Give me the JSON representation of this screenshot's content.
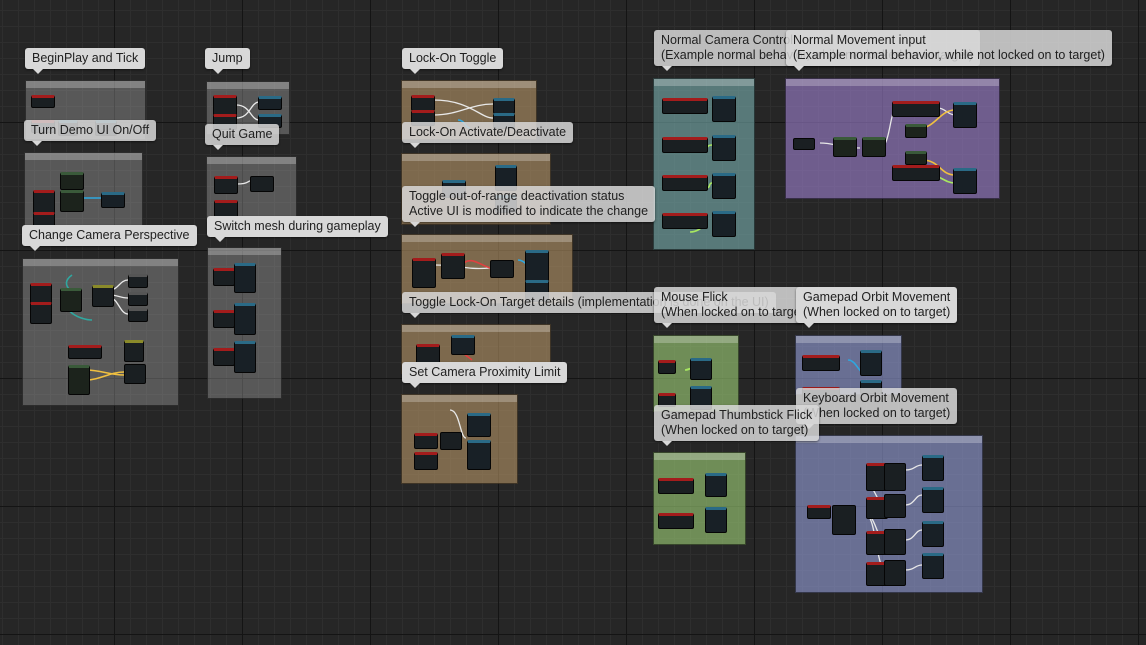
{
  "comments": {
    "begin_play": "BeginPlay and Tick",
    "jump": "Jump",
    "lock_on_toggle": "Lock-On Toggle",
    "normal_camera": "Normal Camera Control\n(Example normal behavior, while not locked on to target)",
    "normal_movement": "Normal Movement input\n(Example normal behavior, while not locked on to target)",
    "demo_ui": "Turn Demo UI On/Off",
    "quit_game": "Quit Game",
    "lock_on_activate": "Lock-On Activate/Deactivate",
    "toggle_range": "Toggle out-of-range deactivation status\nActive UI is modified to indicate the change",
    "switch_mesh": "Switch mesh during gameplay",
    "camera_perspective": "Change Camera Perspective",
    "toggle_details": "Toggle Lock-On Target details (implementation is done on the UI)",
    "mouse_flick": "Mouse Flick\n(When locked on to target)",
    "gamepad_orbit": "Gamepad Orbit Movement\n(When locked on to target)",
    "proximity": "Set Camera Proximity Limit",
    "keyboard_orbit": "Keyboard Orbit Movement\n(When locked on to target)",
    "gamepad_thumbstick": "Gamepad Thumbstick Flick\n(When locked on to target)"
  },
  "colors": {
    "graph_background": "#262626",
    "exec_event": "#a31c1c",
    "function_node": "#2a6a86",
    "bubble": "#d8d8d8"
  }
}
